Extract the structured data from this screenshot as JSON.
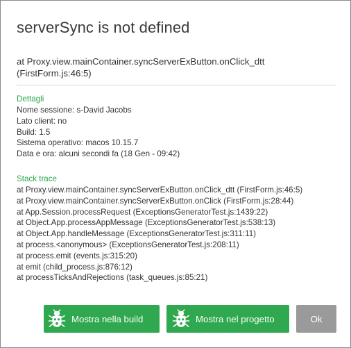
{
  "dialog": {
    "title": "serverSync is not defined",
    "error_location": "at Proxy.view.mainContainer.syncServerExButton.onClick_dtt (FirstForm.js:46:5)"
  },
  "details": {
    "heading": "Dettagli",
    "lines": [
      "Nome sessione: s-David Jacobs",
      "Lato client: no",
      "Build: 1.5",
      "Sistema operativo: macos 10.15.7",
      "Data e ora: alcuni secondi fa (18 Gen - 09:42)"
    ]
  },
  "stack_trace": {
    "heading": "Stack trace",
    "lines": [
      "at Proxy.view.mainContainer.syncServerExButton.onClick_dtt (FirstForm.js:46:5)",
      "at Proxy.view.mainContainer.syncServerExButton.onClick (FirstForm.js:28:44)",
      "at App.Session.processRequest (ExceptionsGeneratorTest.js:1439:22)",
      "at Object.App.processAppMessage (ExceptionsGeneratorTest.js:538:13)",
      "at Object.App.handleMessage (ExceptionsGeneratorTest.js:311:11)",
      "at process.<anonymous> (ExceptionsGeneratorTest.js:208:11)",
      "at process.emit (events.js:315:20)",
      "at emit (child_process.js:876:12)",
      "at processTicksAndRejections (task_queues.js:85:21)"
    ]
  },
  "buttons": {
    "show_in_build": "Mostra nella build",
    "show_in_project": "Mostra nel progetto",
    "ok": "Ok"
  },
  "colors": {
    "accent_green": "#2fa84f",
    "section_green": "#2aa84a",
    "ok_gray": "#9a9a9a"
  },
  "icons": {
    "bug": "bug-icon"
  }
}
